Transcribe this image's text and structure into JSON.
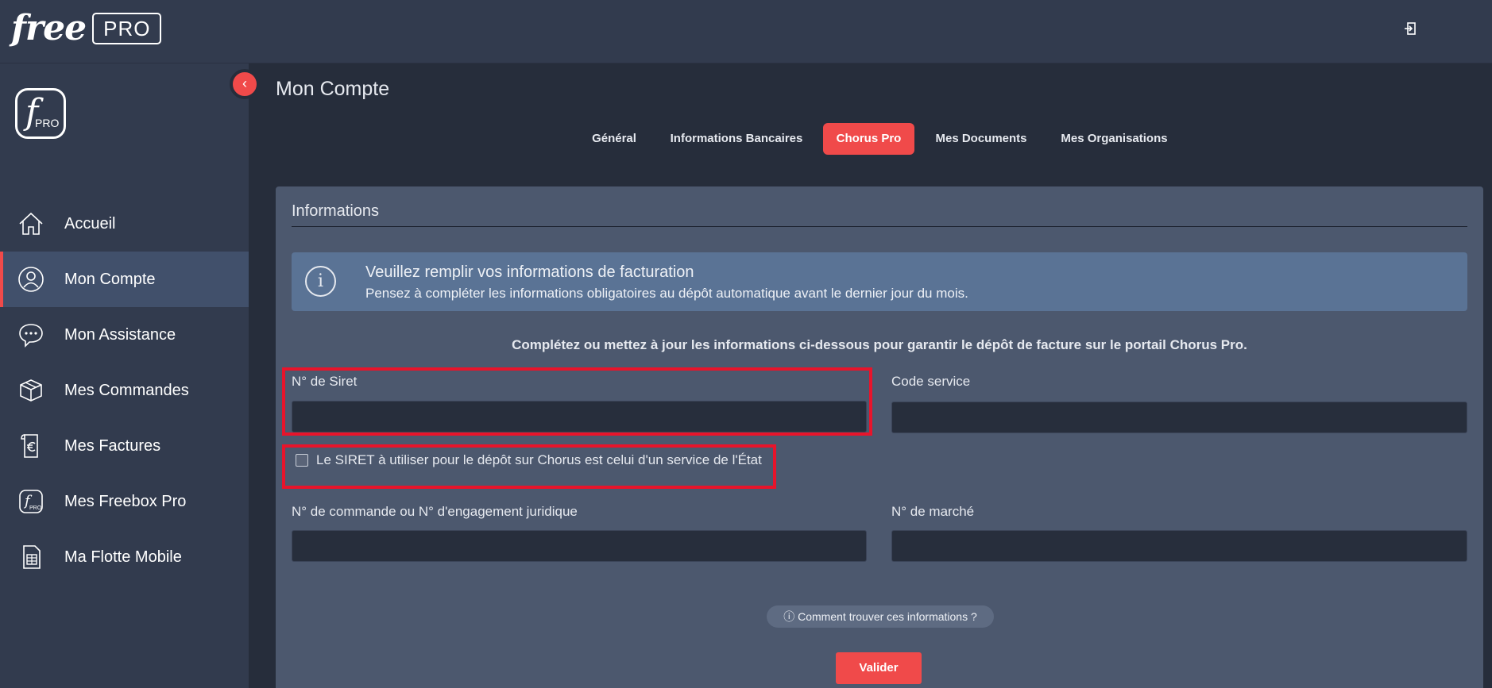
{
  "header": {
    "logo_free": "free",
    "logo_pro": "PRO",
    "logout_icon": "logout-icon"
  },
  "sidebar": {
    "logo_letter": "f",
    "logo_pro": "PRO",
    "collapse_icon": "chevron-left-icon",
    "items": [
      {
        "label": "Accueil",
        "icon": "home-icon",
        "active": false
      },
      {
        "label": "Mon Compte",
        "icon": "user-icon",
        "active": true
      },
      {
        "label": "Mon Assistance",
        "icon": "chat-icon",
        "active": false
      },
      {
        "label": "Mes Commandes",
        "icon": "box-icon",
        "active": false
      },
      {
        "label": "Mes Factures",
        "icon": "invoice-euro-icon",
        "active": false
      },
      {
        "label": "Mes Freebox Pro",
        "icon": "freebox-pro-icon",
        "active": false
      },
      {
        "label": "Ma Flotte Mobile",
        "icon": "sim-card-icon",
        "active": false
      }
    ]
  },
  "main": {
    "title": "Mon Compte",
    "tabs": [
      {
        "label": "Général",
        "active": false
      },
      {
        "label": "Informations Bancaires",
        "active": false
      },
      {
        "label": "Chorus Pro",
        "active": true
      },
      {
        "label": "Mes Documents",
        "active": false
      },
      {
        "label": "Mes Organisations",
        "active": false
      }
    ],
    "panel": {
      "title": "Informations",
      "info": {
        "title": "Veuillez remplir vos informations de facturation",
        "subtitle": "Pensez à compléter les informations obligatoires au dépôt automatique avant le dernier jour du mois."
      },
      "intro": "Complétez ou mettez à jour les informations ci-dessous pour garantir le dépôt de facture sur le portail Chorus Pro.",
      "fields": {
        "siret_label": "N° de Siret",
        "siret_value": "",
        "code_service_label": "Code service",
        "code_service_value": "",
        "commande_label": "N° de commande ou N° d'engagement juridique",
        "commande_value": "",
        "marche_label": "N° de marché",
        "marche_value": ""
      },
      "checkbox_label": "Le SIRET à utiliser pour le dépôt sur Chorus est celui d'un service de l'État",
      "checkbox_checked": false,
      "help_label": "ⓘ Comment trouver ces informations ?",
      "submit_label": "Valider"
    }
  },
  "colors": {
    "accent": "#f04a4a",
    "highlight": "#e8142b",
    "sidebar_bg": "#323b4e",
    "panel_bg": "#4c586e"
  }
}
